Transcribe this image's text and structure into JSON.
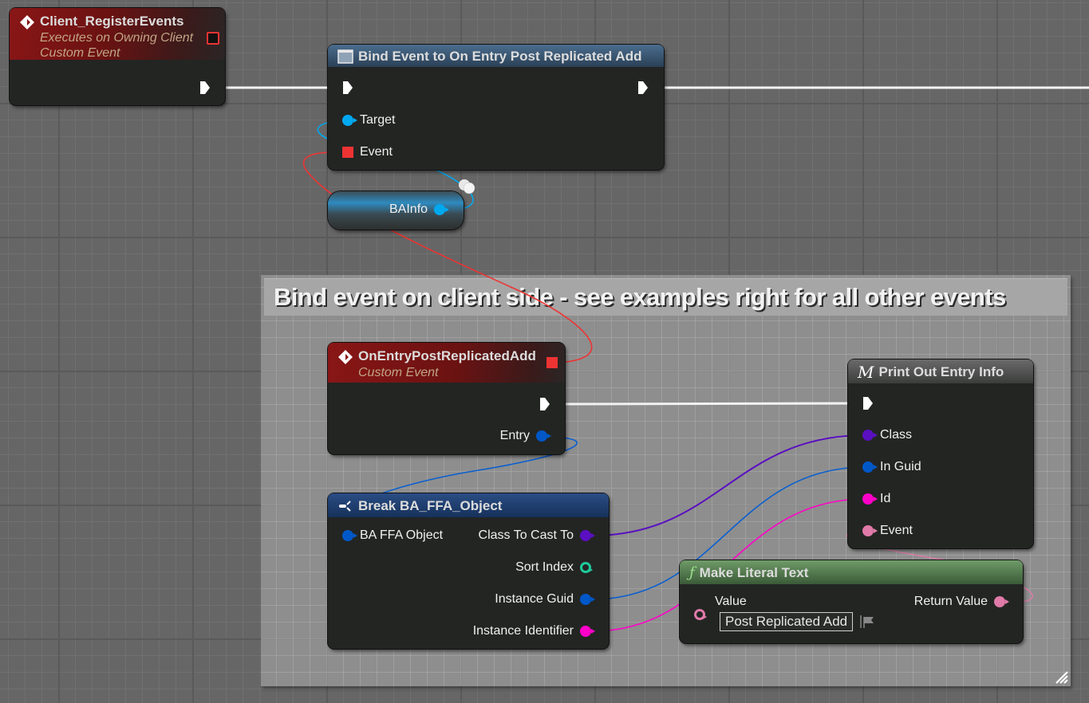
{
  "graph": {
    "comment": {
      "title": "Bind event on client side - see examples right for all other events"
    },
    "nodes": {
      "client_register_events": {
        "title": "Client_RegisterEvents",
        "subtitle1": "Executes on Owning Client",
        "subtitle2": "Custom Event",
        "icon": "event-diamond-icon"
      },
      "bind_event": {
        "title": "Bind Event to On Entry Post Replicated Add",
        "icon": "function-window-icon",
        "pins": {
          "target": "Target",
          "event": "Event"
        }
      },
      "bainfo_var": {
        "label": "BAInfo"
      },
      "on_entry_post_replicated_add": {
        "title": "OnEntryPostReplicatedAdd",
        "subtitle": "Custom Event",
        "pins": {
          "entry": "Entry"
        }
      },
      "break_ba_ffa_object": {
        "title": "Break BA_FFA_Object",
        "icon": "break-struct-icon",
        "pins": {
          "ba_ffa_object": "BA FFA Object",
          "class_to_cast_to": "Class To Cast To",
          "sort_index": "Sort Index",
          "instance_guid": "Instance Guid",
          "instance_identifier": "Instance Identifier"
        }
      },
      "print_out_entry_info": {
        "title": "Print Out Entry Info",
        "icon_glyph": "M",
        "pins": {
          "class": "Class",
          "in_guid": "In Guid",
          "id": "Id",
          "event": "Event"
        }
      },
      "make_literal_text": {
        "title": "Make Literal Text",
        "icon_glyph": "ƒ",
        "pins": {
          "value": "Value",
          "return_value": "Return Value"
        },
        "value_input": "Post Replicated Add"
      }
    },
    "colors": {
      "exec": "#ffffff",
      "delegate": "#ee3333",
      "object": "#00a8f0",
      "struct": "#0058c8",
      "class": "#5a10c0",
      "int": "#1fc99a",
      "guid": "#0058c8",
      "name": "#ff00c8",
      "text": "#e07aa8"
    }
  }
}
